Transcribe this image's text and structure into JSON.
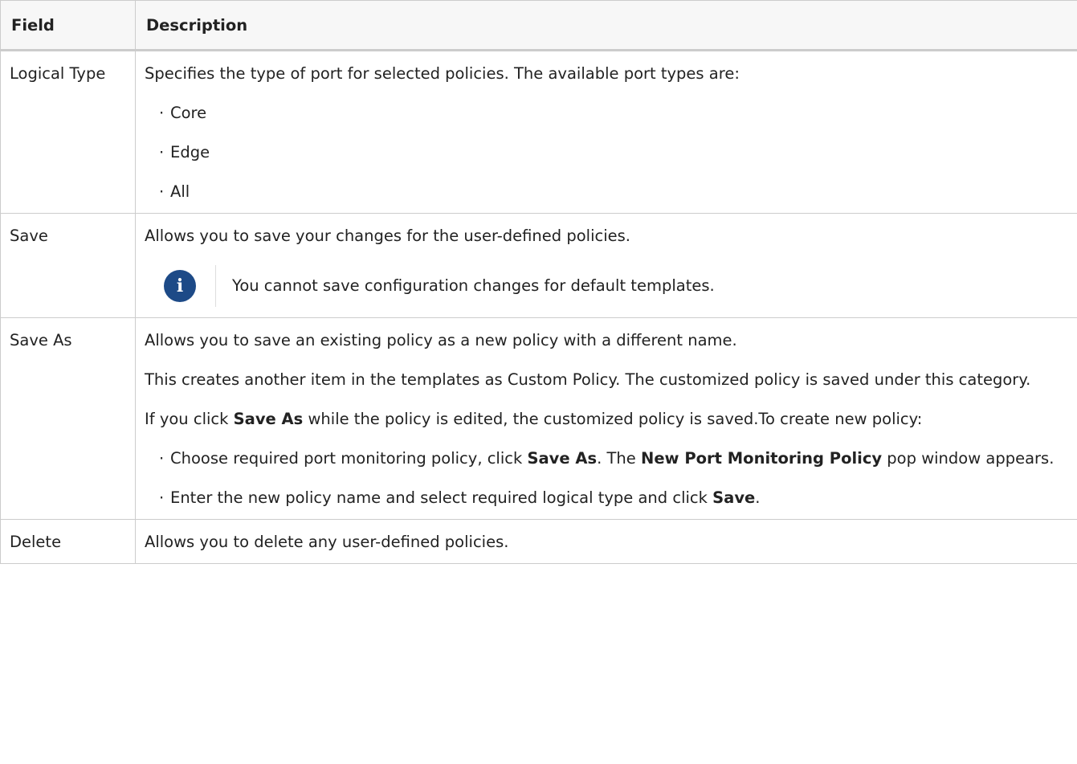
{
  "header": {
    "field": "Field",
    "description": "Description"
  },
  "rows": {
    "logical_type": {
      "field": "Logical Type",
      "intro": "Specifies the type of port for selected policies. The available port types are:",
      "bullet": "·",
      "items": [
        "Core",
        "Edge",
        "All"
      ]
    },
    "save": {
      "field": "Save",
      "desc": "Allows you to save your changes for the user-defined policies.",
      "note_icon": "info-icon",
      "note_icon_glyph": "i",
      "note": "You cannot save configuration changes for default templates."
    },
    "save_as": {
      "field": "Save As",
      "p1": "Allows you to save an existing policy as a new policy with a different name.",
      "p2": "This creates another item in the templates as Custom Policy. The customized policy is saved under this category.",
      "p3_a": "If you click ",
      "p3_b": "Save As",
      "p3_c": " while the policy is edited, the customized policy is saved.To create new policy:",
      "li1_a": "Choose required port monitoring policy, click ",
      "li1_b": "Save As",
      "li1_c": ". The ",
      "li1_d": "New Port Monitoring Policy",
      "li1_e": " pop window appears.",
      "li2_a": "Enter the new policy name and select required logical type and click ",
      "li2_b": "Save",
      "li2_c": "."
    },
    "delete": {
      "field": "Delete",
      "desc": "Allows you to delete any user-defined policies."
    }
  }
}
